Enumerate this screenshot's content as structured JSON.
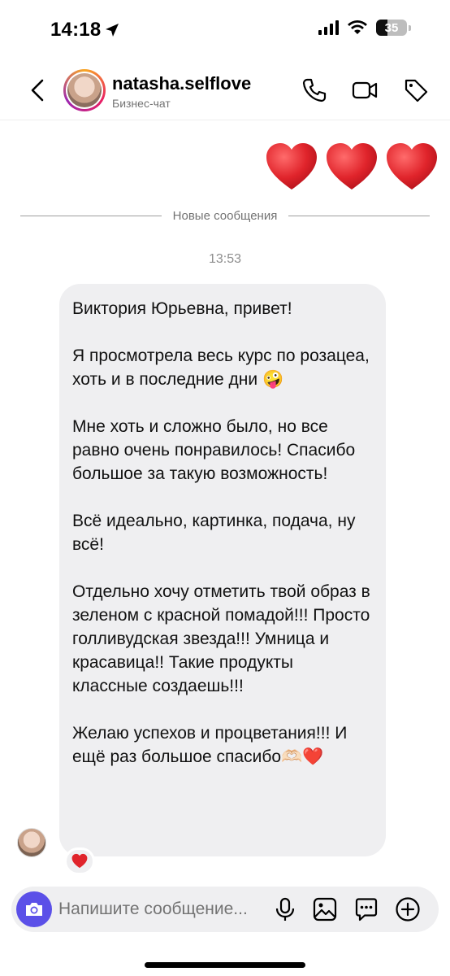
{
  "status_bar": {
    "time": "14:18",
    "battery": "35",
    "icons": [
      "location-arrow-icon",
      "signal-icon",
      "wifi-icon",
      "battery-icon"
    ]
  },
  "header": {
    "name": "natasha.selflove",
    "subtitle": "Бизнес-чат",
    "icons": [
      "back-chevron-icon",
      "phone-icon",
      "video-icon",
      "tag-icon"
    ]
  },
  "divider_label": "Новые сообщения",
  "timestamp": "13:53",
  "message": {
    "paragraphs": [
      "Виктория Юрьевна, привет!",
      "Я просмотрела весь курс по розацеа, хоть и в последние дни 🤪",
      "Мне хоть и сложно было, но все равно очень понравилось! Спасибо большое за такую возможность!",
      "Всё идеально, картинка, подача, ну всё!",
      "Отдельно хочу отметить твой образ в зеленом с красной помадой!!! Просто голливудская звезда!!! Умница и красавица!! Такие продукты классные создаешь!!!",
      "Желаю успехов и процветания!!! И ещё раз большое спасибо🫶🏻❤️"
    ],
    "reaction": "❤️"
  },
  "sent_reaction": "❤️❤️❤️",
  "composer": {
    "placeholder": "Напишите сообщение...",
    "icons": [
      "camera-icon",
      "microphone-icon",
      "gallery-icon",
      "sticker-icon",
      "add-icon"
    ]
  },
  "colors": {
    "accent": "#5b50e8",
    "bubble": "#efeff1",
    "heart": "#e0242b"
  }
}
